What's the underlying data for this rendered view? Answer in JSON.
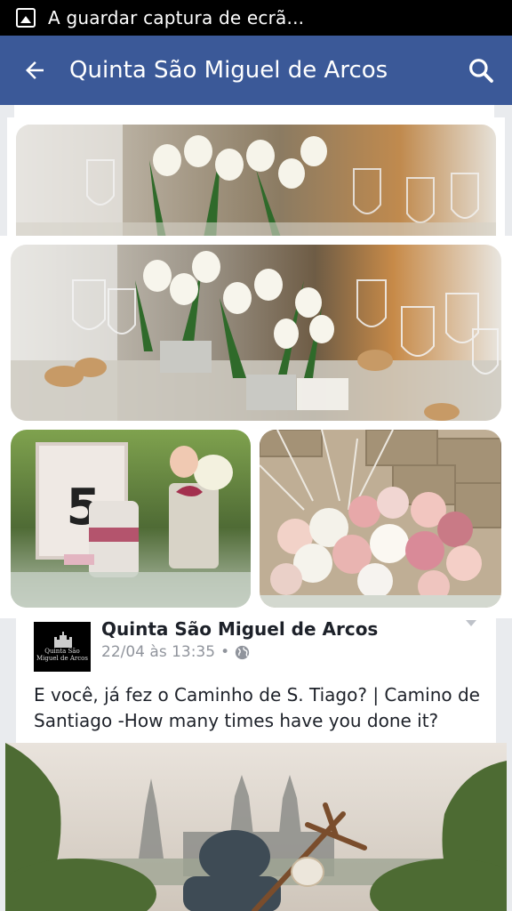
{
  "status_bar": {
    "icon": "screenshot-notification-icon",
    "text": "A guardar captura de ecrã..."
  },
  "app_bar": {
    "back_icon": "arrow-left-icon",
    "title": "Quinta São Miguel de Arcos",
    "search_icon": "search-icon",
    "color": "#3b5998"
  },
  "photo_grid": {
    "main_photo": "table-tulips-photo",
    "left_photo": "table-number-five-photo",
    "right_photo": "rose-bouquet-photo"
  },
  "post": {
    "author": "Quinta São Miguel de Arcos",
    "timestamp": "22/04 às 13:35",
    "privacy_icon": "globe-icon",
    "text": "E você, já fez o Caminho de S. Tiago? | Camino de Santiago -How many times have you done it?",
    "avatar_label": "Quinta São Miguel de Arcos"
  },
  "post_image": "pilgrim-santiago-photo"
}
